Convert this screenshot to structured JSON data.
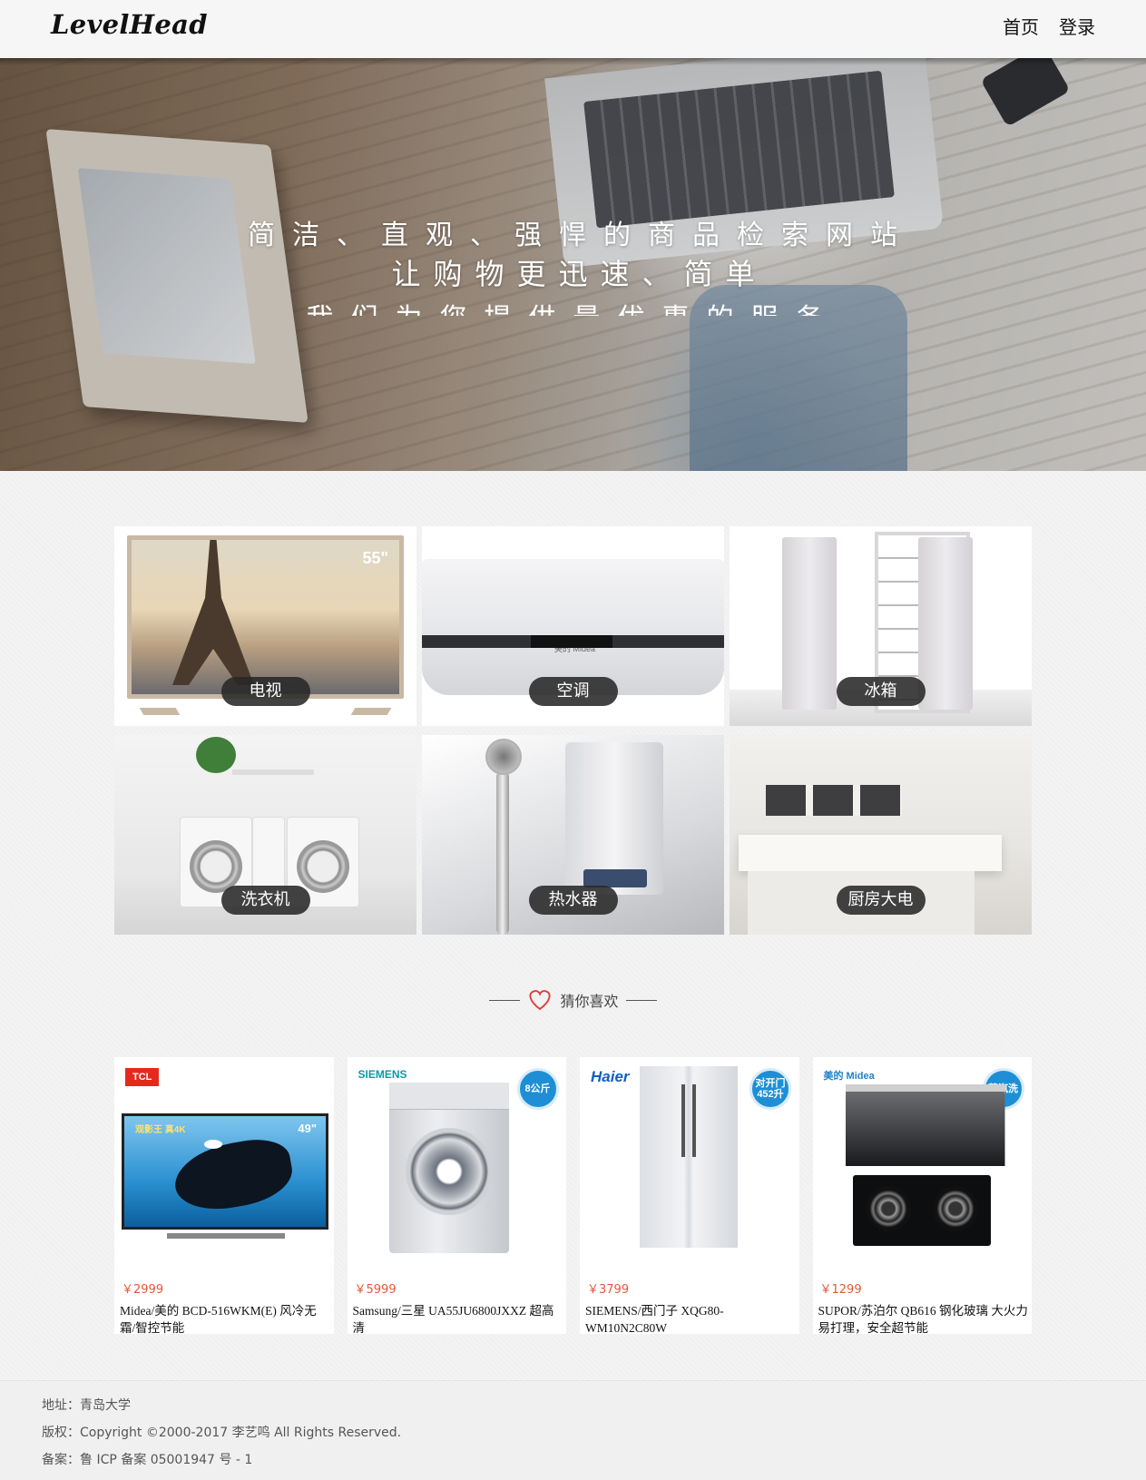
{
  "header": {
    "logo": "LevelHead",
    "nav": [
      "首页",
      "登录"
    ]
  },
  "hero": {
    "line1": "简洁、直观、强悍的商品检索网站",
    "line2": "让购物更迅速、简单",
    "line3": "我们为您提供最优惠的服务"
  },
  "categories": [
    {
      "label": "电视",
      "size_text": "55\""
    },
    {
      "label": "空调",
      "brand_text": "美的 Midea"
    },
    {
      "label": "冰箱"
    },
    {
      "label": "洗衣机"
    },
    {
      "label": "热水器"
    },
    {
      "label": "厨房大电"
    }
  ],
  "section_title": "猜你喜欢",
  "products": [
    {
      "brand": "TCL",
      "badge": "",
      "screen_text": "观影王 真4K",
      "size_text": "49\"",
      "price": "￥2999",
      "name": "Midea/美的 BCD-516WKM(E) 风冷无霜/智控节能"
    },
    {
      "brand": "SIEMENS",
      "badge": "8公斤",
      "price": "￥5999",
      "name": "Samsung/三星 UA55JU6800JXXZ 超高清"
    },
    {
      "brand": "Haier",
      "badge": "对开门 452升",
      "price": "￥3799",
      "name": "SIEMENS/西门子 XQG80-WM10N2C80W"
    },
    {
      "brand": "美的 Midea",
      "badge": "蒸汽洗",
      "price": "￥1299",
      "name": "SUPOR/苏泊尔 QB616 钢化玻璃 大火力易打理，安全超节能"
    }
  ],
  "footer": {
    "address": "地址：青岛大学",
    "copyright": "版权：Copyright ©2000-2017 李艺鸣 All Rights Reserved.",
    "icp": "备案：鲁 ICP 备案 05001947 号 - 1"
  },
  "colors": {
    "price": "#e4573b",
    "label_bg": "#2e2e2e",
    "badge": "#1e8fd6"
  }
}
